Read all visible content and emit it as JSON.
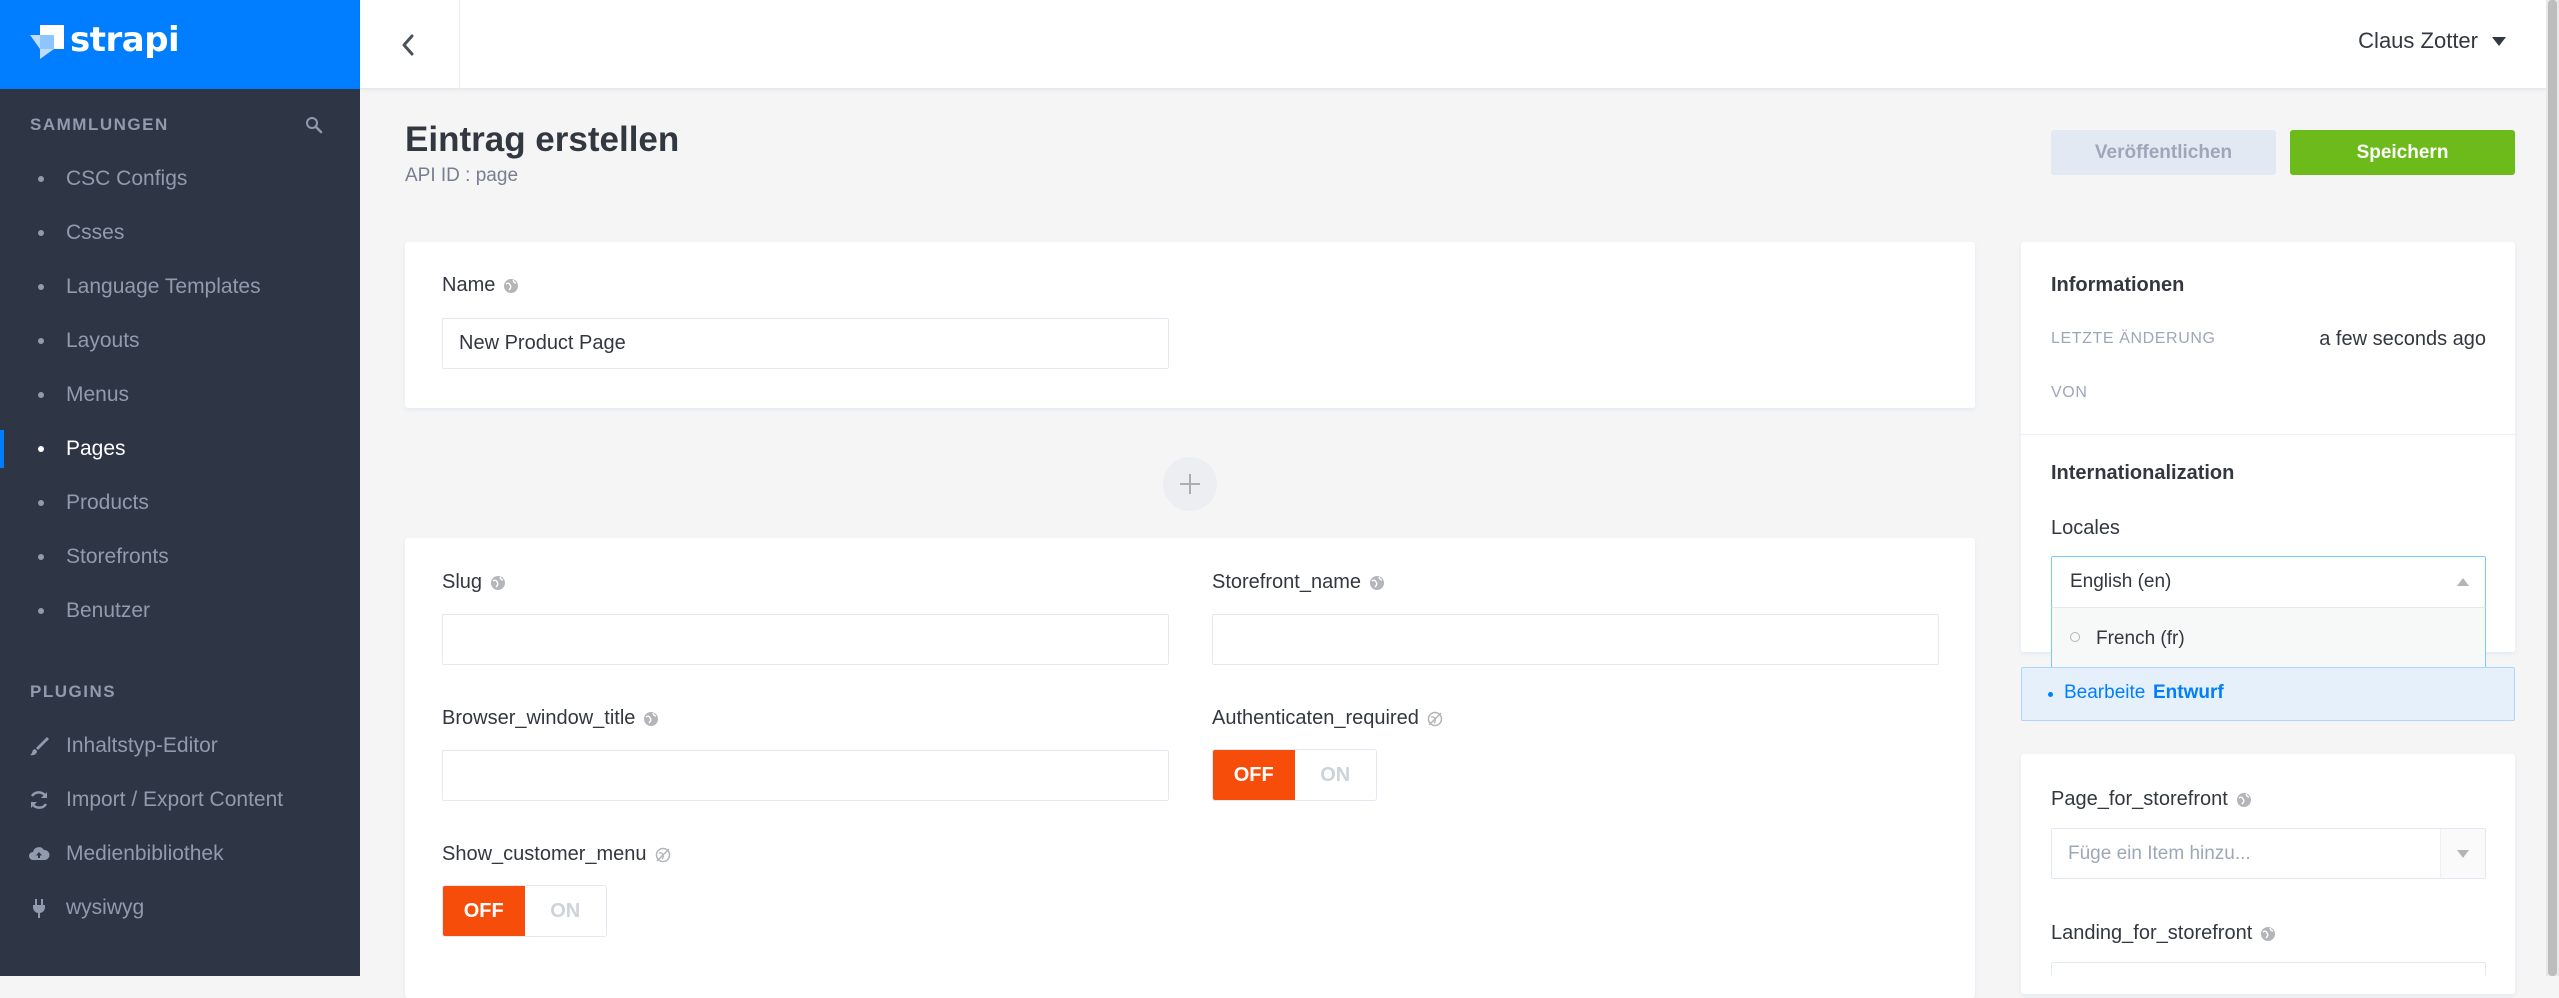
{
  "brand": {
    "name": "strapi",
    "color": "#007eff"
  },
  "sidebar": {
    "collections_title": "SAMMLUNGEN",
    "items": [
      {
        "label": "CSC Configs",
        "active": false
      },
      {
        "label": "Csses",
        "active": false
      },
      {
        "label": "Language Templates",
        "active": false
      },
      {
        "label": "Layouts",
        "active": false
      },
      {
        "label": "Menus",
        "active": false
      },
      {
        "label": "Pages",
        "active": true
      },
      {
        "label": "Products",
        "active": false
      },
      {
        "label": "Storefronts",
        "active": false
      },
      {
        "label": "Benutzer",
        "active": false
      }
    ],
    "plugins_title": "PLUGINS",
    "plugins": [
      {
        "label": "Inhaltstyp-Editor",
        "icon": "paintbrush-icon"
      },
      {
        "label": "Import / Export Content",
        "icon": "sync-icon"
      },
      {
        "label": "Medienbibliothek",
        "icon": "cloud-upload-icon"
      },
      {
        "label": "wysiwyg",
        "icon": "plug-icon"
      }
    ]
  },
  "header": {
    "user_name": "Claus Zotter"
  },
  "page": {
    "title": "Eintrag erstellen",
    "api_id": "API ID : page",
    "publish_label": "Veröffentlichen",
    "save_label": "Speichern"
  },
  "form": {
    "name_label": "Name",
    "name_value": "New Product Page",
    "slug_label": "Slug",
    "slug_value": "",
    "storefront_name_label": "Storefront_name",
    "storefront_name_value": "",
    "browser_window_title_label": "Browser_window_title",
    "browser_window_title_value": "",
    "authenticaten_required_label": "Authenticaten_required",
    "show_customer_menu_label": "Show_customer_menu",
    "toggle_off": "OFF",
    "toggle_on": "ON"
  },
  "info": {
    "title": "Informationen",
    "last_change_key": "LETZTE ÄNDERUNG",
    "last_change_value": "a few seconds ago",
    "by_key": "VON"
  },
  "i18n": {
    "title": "Internationalization",
    "locales_label": "Locales",
    "selected_locale": "English (en)",
    "options": [
      "French (fr)"
    ]
  },
  "draft": {
    "prefix": "Bearbeite",
    "state": "Entwurf"
  },
  "relations": {
    "page_for_storefront_label": "Page_for_storefront",
    "page_for_storefront_placeholder": "Füge ein Item hinzu...",
    "landing_for_storefront_label": "Landing_for_storefront"
  }
}
